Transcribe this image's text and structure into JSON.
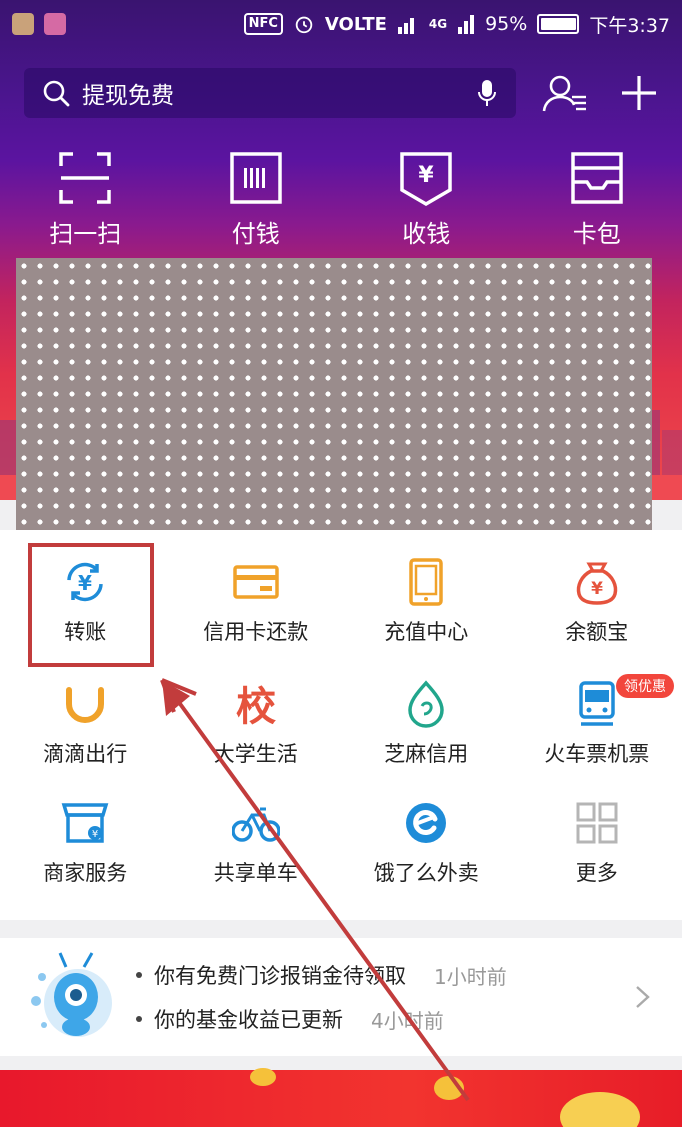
{
  "statusbar": {
    "nfc": "NFC",
    "network": "VOLTE",
    "lte": "4G",
    "battery": "95%",
    "time": "下午3:37"
  },
  "search": {
    "placeholder": "提现免费"
  },
  "quick_actions": [
    {
      "label": "扫一扫",
      "icon": "scan-icon"
    },
    {
      "label": "付钱",
      "icon": "barcode-icon"
    },
    {
      "label": "收钱",
      "icon": "yuan-receive-icon"
    },
    {
      "label": "卡包",
      "icon": "card-wallet-icon"
    }
  ],
  "grid": [
    {
      "label": "转账",
      "icon": "transfer-yuan-icon"
    },
    {
      "label": "信用卡还款",
      "icon": "credit-card-icon"
    },
    {
      "label": "充值中心",
      "icon": "phone-recharge-icon"
    },
    {
      "label": "余额宝",
      "icon": "money-bag-icon"
    },
    {
      "label": "滴滴出行",
      "icon": "didi-icon"
    },
    {
      "label": "大学生活",
      "icon": "campus-icon",
      "glyph": "校"
    },
    {
      "label": "芝麻信用",
      "icon": "sesame-icon"
    },
    {
      "label": "火车票机票",
      "icon": "train-icon",
      "badge": "领优惠"
    },
    {
      "label": "商家服务",
      "icon": "shop-icon"
    },
    {
      "label": "共享单车",
      "icon": "bike-icon"
    },
    {
      "label": "饿了么外卖",
      "icon": "eleme-icon"
    },
    {
      "label": "更多",
      "icon": "more-grid-icon"
    }
  ],
  "notices": [
    {
      "text": "你有免费门诊报销金待领取",
      "time": "1小时前"
    },
    {
      "text": "你的基金收益已更新",
      "time": "4小时前"
    }
  ],
  "colors": {
    "blue": "#1e8cd8",
    "orange": "#f0a22a",
    "red": "#e53e3e",
    "teal": "#21a68c",
    "highlight": "#c23c3c"
  }
}
